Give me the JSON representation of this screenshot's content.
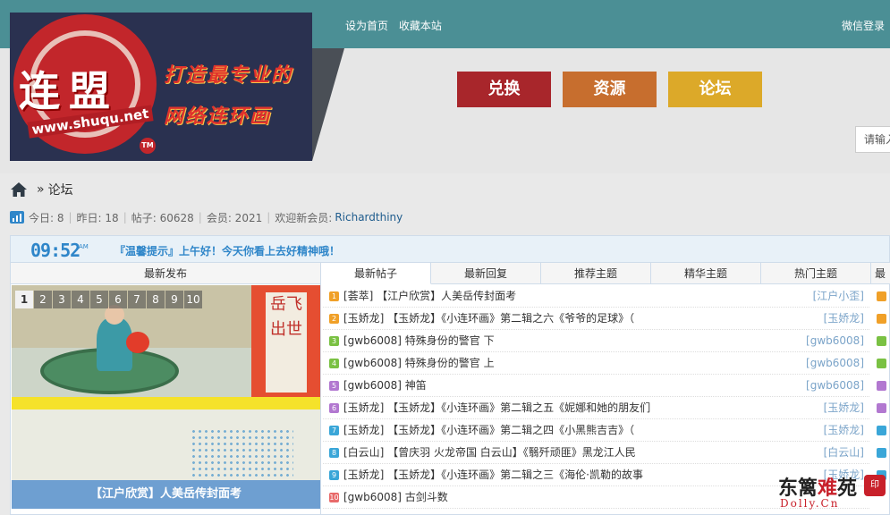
{
  "topbar": {
    "links": [
      "设为首页",
      "收藏本站"
    ],
    "wechat_login": "微信登录"
  },
  "logo": {
    "main_text": "连盟",
    "site": "www.shuqu.net",
    "tm": "TM",
    "slogan_line1": "打造最专业的",
    "slogan_line2": "网络连环画"
  },
  "nav": {
    "items": [
      {
        "label": "兑换",
        "color": "#a8262b"
      },
      {
        "label": "资源",
        "color": "#c76e2e"
      },
      {
        "label": "论坛",
        "color": "#dca929"
      }
    ]
  },
  "search": {
    "placeholder": "请输入"
  },
  "breadcrumb": {
    "sep": "»",
    "current": "论坛"
  },
  "stats": {
    "today": "今日: 8",
    "yesterday": "昨日: 18",
    "posts": "帖子: 60628",
    "members": "会员: 2021",
    "welcome": "欢迎新会员:",
    "newest_member": "Richardthiny"
  },
  "greeting": {
    "clock": "09:52",
    "ampm": "AM",
    "message": "『温馨提示』上午好！今天你看上去好精神哦！"
  },
  "left_panel": {
    "heading": "最新发布",
    "slide_numbers": [
      "1",
      "2",
      "3",
      "4",
      "5",
      "6",
      "7",
      "8",
      "9",
      "10"
    ],
    "active_slide": "1",
    "panel_text": "岳飞出世",
    "caption": "【江户欣赏】人美岳传封面考"
  },
  "tabs": [
    "最新帖子",
    "最新回复",
    "推荐主题",
    "精华主题",
    "热门主题",
    "最"
  ],
  "posts": [
    {
      "num": "1",
      "color": "#f0a028",
      "title": "[荟萃] 【江户欣赏】人美岳传封面考",
      "author": "[江户小歪]"
    },
    {
      "num": "2",
      "color": "#f0a028",
      "title": "[玉娇龙] 【玉娇龙】《小连环画》第二辑之六《爷爷的足球》（",
      "author": "[玉娇龙]"
    },
    {
      "num": "3",
      "color": "#7ac143",
      "title": "[gwb6008] 特殊身份的警官 下",
      "author": "[gwb6008]"
    },
    {
      "num": "4",
      "color": "#7ac143",
      "title": "[gwb6008] 特殊身份的警官 上",
      "author": "[gwb6008]"
    },
    {
      "num": "5",
      "color": "#b278d0",
      "title": "[gwb6008] 神笛",
      "author": "[gwb6008]"
    },
    {
      "num": "6",
      "color": "#b278d0",
      "title": "[玉娇龙] 【玉娇龙】《小连环画》第二辑之五《妮娜和她的朋友们",
      "author": "[玉娇龙]"
    },
    {
      "num": "7",
      "color": "#3aa6d8",
      "title": "[玉娇龙] 【玉娇龙】《小连环画》第二辑之四《小黑熊吉吉》（",
      "author": "[玉娇龙]"
    },
    {
      "num": "8",
      "color": "#3aa6d8",
      "title": "[白云山] 【曾庆羽 火龙帝国 白云山】《翳歼顽匪》黑龙江人民",
      "author": "[白云山]"
    },
    {
      "num": "9",
      "color": "#3aa6d8",
      "title": "[玉娇龙] 【玉娇龙】《小连环画》第二辑之三《海伦·凯勒的故事",
      "author": "[玉娇龙]"
    },
    {
      "num": "10",
      "color": "#e86a6a",
      "title": "[gwb6008] 古剑斗数",
      "author": ""
    }
  ],
  "watermark": {
    "line1_a": "东篱",
    "line1_b": "难",
    "line1_c": "苑",
    "line2": "Dolly.Cn",
    "seal": "印"
  }
}
